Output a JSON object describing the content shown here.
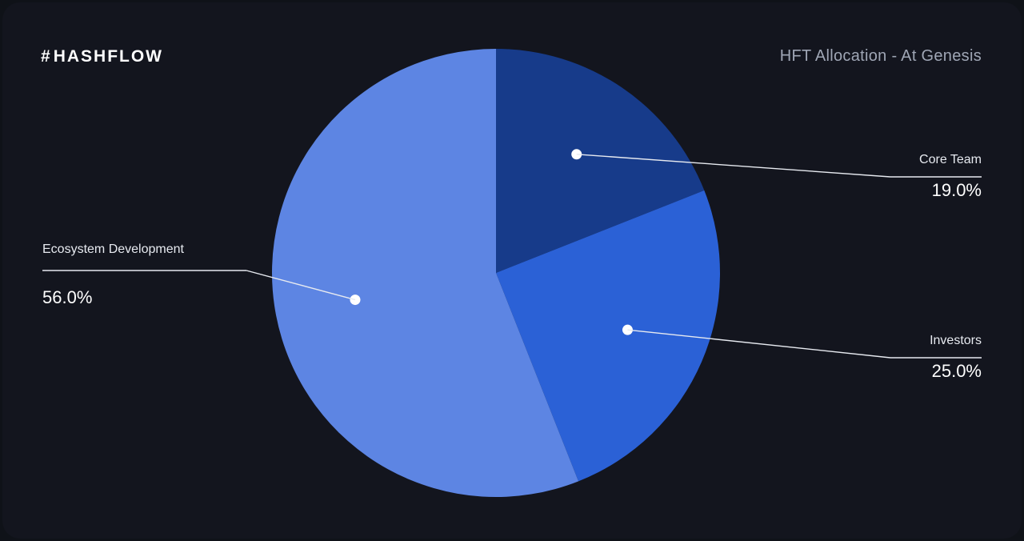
{
  "brand": "HASHFLOW",
  "title": "HFT Allocation - At Genesis",
  "chart_data": {
    "type": "pie",
    "title": "HFT Allocation - At Genesis",
    "series": [
      {
        "name": "Core Team",
        "value": 19.0,
        "color": "#173b8a"
      },
      {
        "name": "Investors",
        "value": 25.0,
        "color": "#2b61d6"
      },
      {
        "name": "Ecosystem Development",
        "value": 56.0,
        "color": "#5d85e3"
      }
    ]
  },
  "labels": {
    "core_team": {
      "name": "Core Team",
      "value": "19.0%"
    },
    "investors": {
      "name": "Investors",
      "value": "25.0%"
    },
    "ecosystem": {
      "name": "Ecosystem Development",
      "value": "56.0%"
    }
  }
}
